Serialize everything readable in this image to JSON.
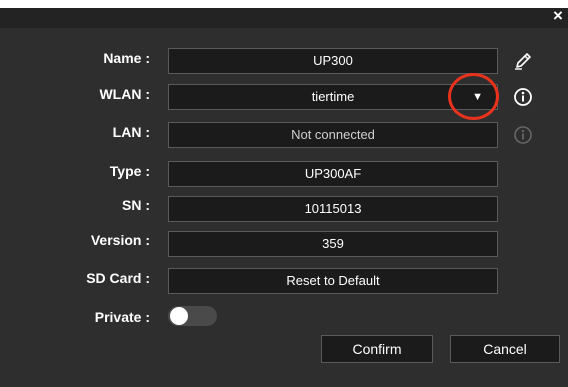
{
  "dialog": {
    "close_glyph": "×"
  },
  "fields": {
    "name": {
      "label": "Name :",
      "value": "UP300"
    },
    "wlan": {
      "label": "WLAN :",
      "value": "tiertime",
      "arrow": "▼"
    },
    "lan": {
      "label": "LAN :",
      "value": "Not connected"
    },
    "type": {
      "label": "Type :",
      "value": "UP300AF"
    },
    "sn": {
      "label": "SN :",
      "value": "10115013"
    },
    "version": {
      "label": "Version :",
      "value": "359"
    },
    "sd_card": {
      "label": "SD Card :",
      "value": "Reset to Default"
    },
    "private": {
      "label": "Private :",
      "state": "off"
    }
  },
  "buttons": {
    "confirm": "Confirm",
    "cancel": "Cancel"
  },
  "icons": {
    "name_side": "edit-pencil-icon",
    "wlan_side": "info-icon",
    "lan_side": "info-icon-disabled"
  },
  "colors": {
    "background": "#2e2e2e",
    "field_bg": "#1b1b1b",
    "annotation": "#e8321c"
  }
}
